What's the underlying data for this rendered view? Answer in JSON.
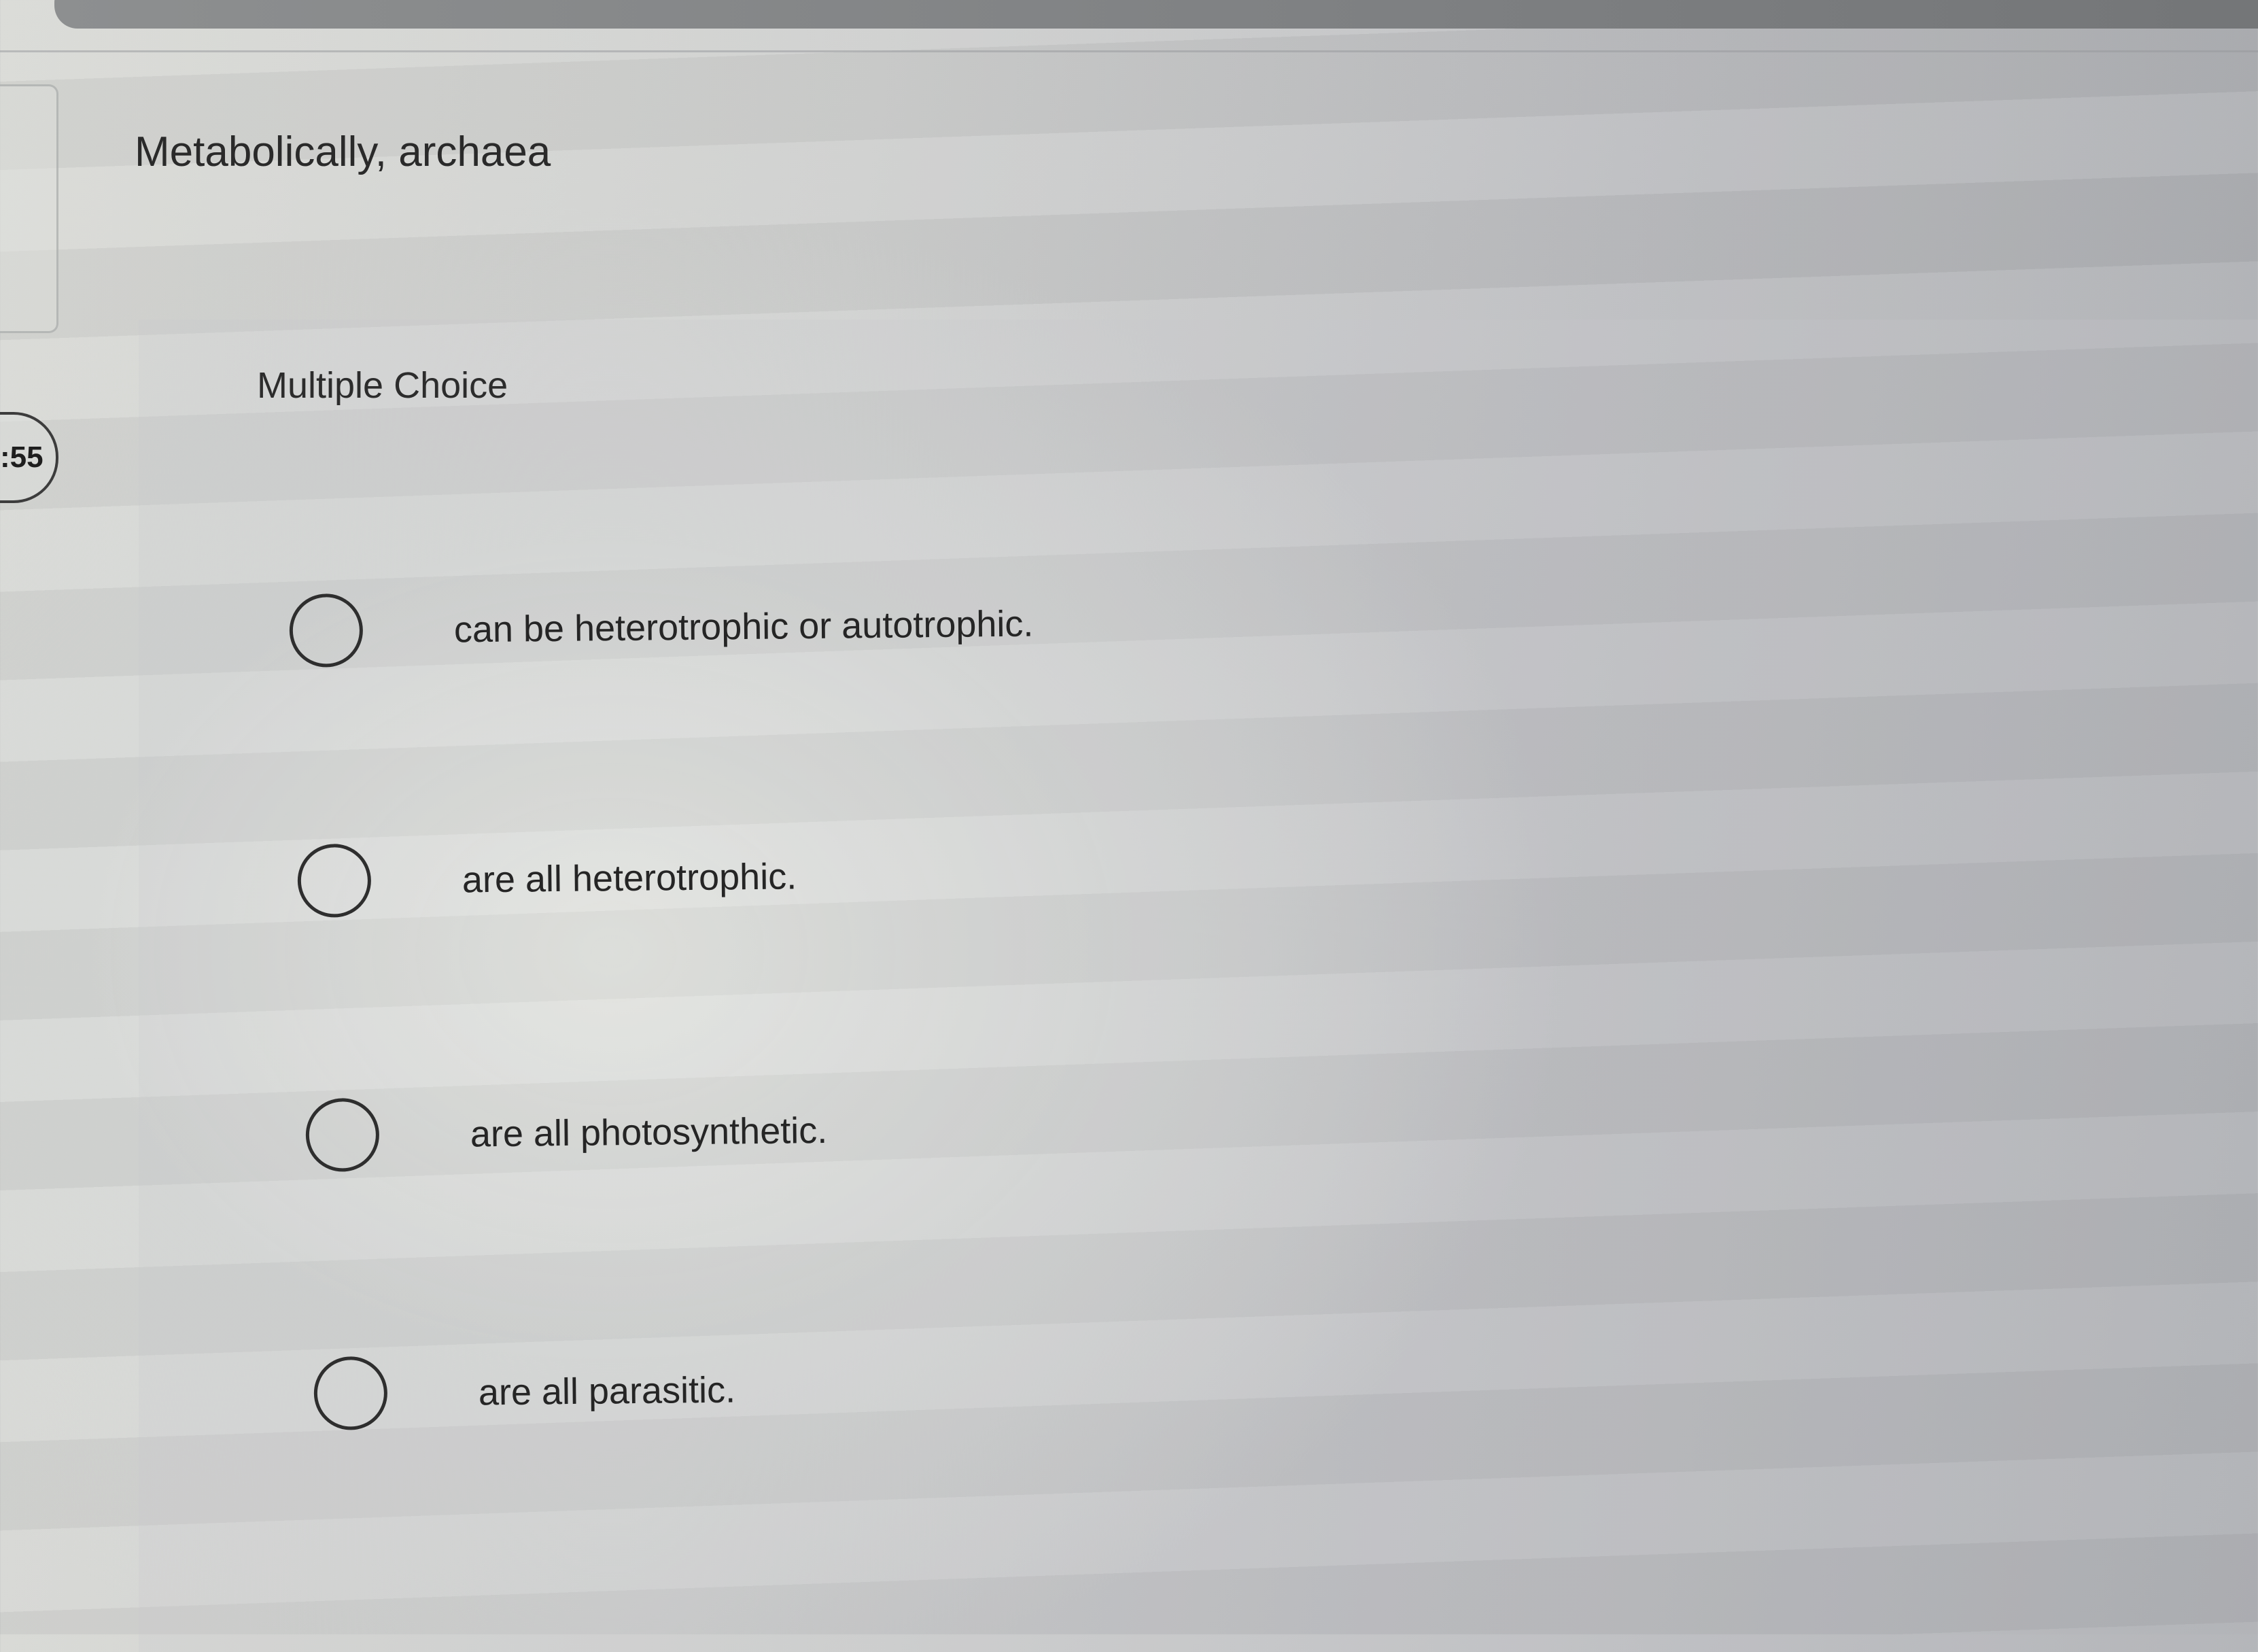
{
  "timer": {
    "text": ":55"
  },
  "question": {
    "prompt": "Metabolically, archaea",
    "type_label": "Multiple Choice",
    "choices": [
      {
        "label": "can be heterotrophic or autotrophic.",
        "selected": false
      },
      {
        "label": "are all heterotrophic.",
        "selected": false
      },
      {
        "label": "are all photosynthetic.",
        "selected": false
      },
      {
        "label": "are all parasitic.",
        "selected": false
      }
    ]
  },
  "colors": {
    "text": "#2b2b2b",
    "radio_border": "#2e2e2e",
    "top_bar": "#808284"
  }
}
